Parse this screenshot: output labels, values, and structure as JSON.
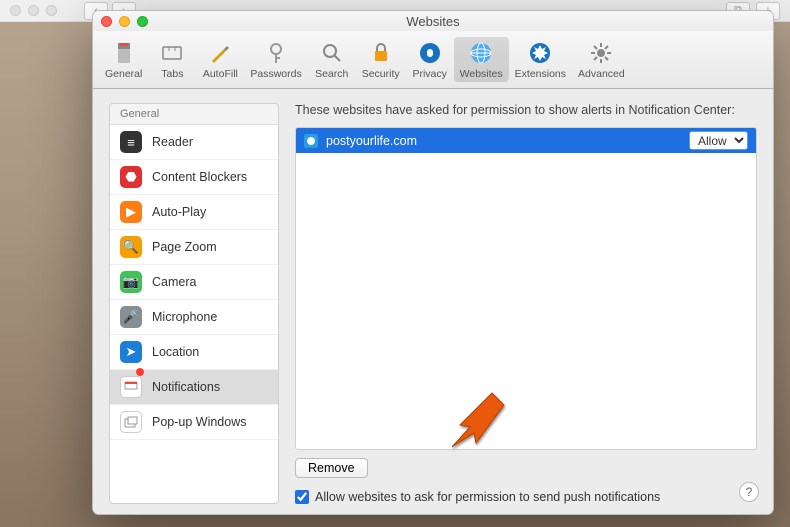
{
  "window": {
    "title": "Websites"
  },
  "toolbar": {
    "items": [
      {
        "id": "general",
        "label": "General"
      },
      {
        "id": "tabs",
        "label": "Tabs"
      },
      {
        "id": "autofill",
        "label": "AutoFill"
      },
      {
        "id": "passwords",
        "label": "Passwords"
      },
      {
        "id": "search",
        "label": "Search"
      },
      {
        "id": "security",
        "label": "Security"
      },
      {
        "id": "privacy",
        "label": "Privacy"
      },
      {
        "id": "websites",
        "label": "Websites"
      },
      {
        "id": "extensions",
        "label": "Extensions"
      },
      {
        "id": "advanced",
        "label": "Advanced"
      }
    ],
    "selected": "websites"
  },
  "sidebar": {
    "header": "General",
    "items": [
      {
        "id": "reader",
        "label": "Reader"
      },
      {
        "id": "content-blockers",
        "label": "Content Blockers"
      },
      {
        "id": "auto-play",
        "label": "Auto-Play"
      },
      {
        "id": "page-zoom",
        "label": "Page Zoom"
      },
      {
        "id": "camera",
        "label": "Camera"
      },
      {
        "id": "microphone",
        "label": "Microphone"
      },
      {
        "id": "location",
        "label": "Location"
      },
      {
        "id": "notifications",
        "label": "Notifications"
      },
      {
        "id": "popup",
        "label": "Pop-up Windows"
      }
    ],
    "selected": "notifications"
  },
  "main": {
    "description": "These websites have asked for permission to show alerts in Notification Center:",
    "rows": [
      {
        "domain": "postyourlife.com",
        "permission": "Allow"
      }
    ],
    "remove_label": "Remove",
    "checkbox_label": "Allow websites to ask for permission to send push notifications",
    "checkbox_checked": true
  },
  "help_label": "?",
  "colors": {
    "selection_blue": "#1e6fe0",
    "arrow": "#e8590c"
  }
}
